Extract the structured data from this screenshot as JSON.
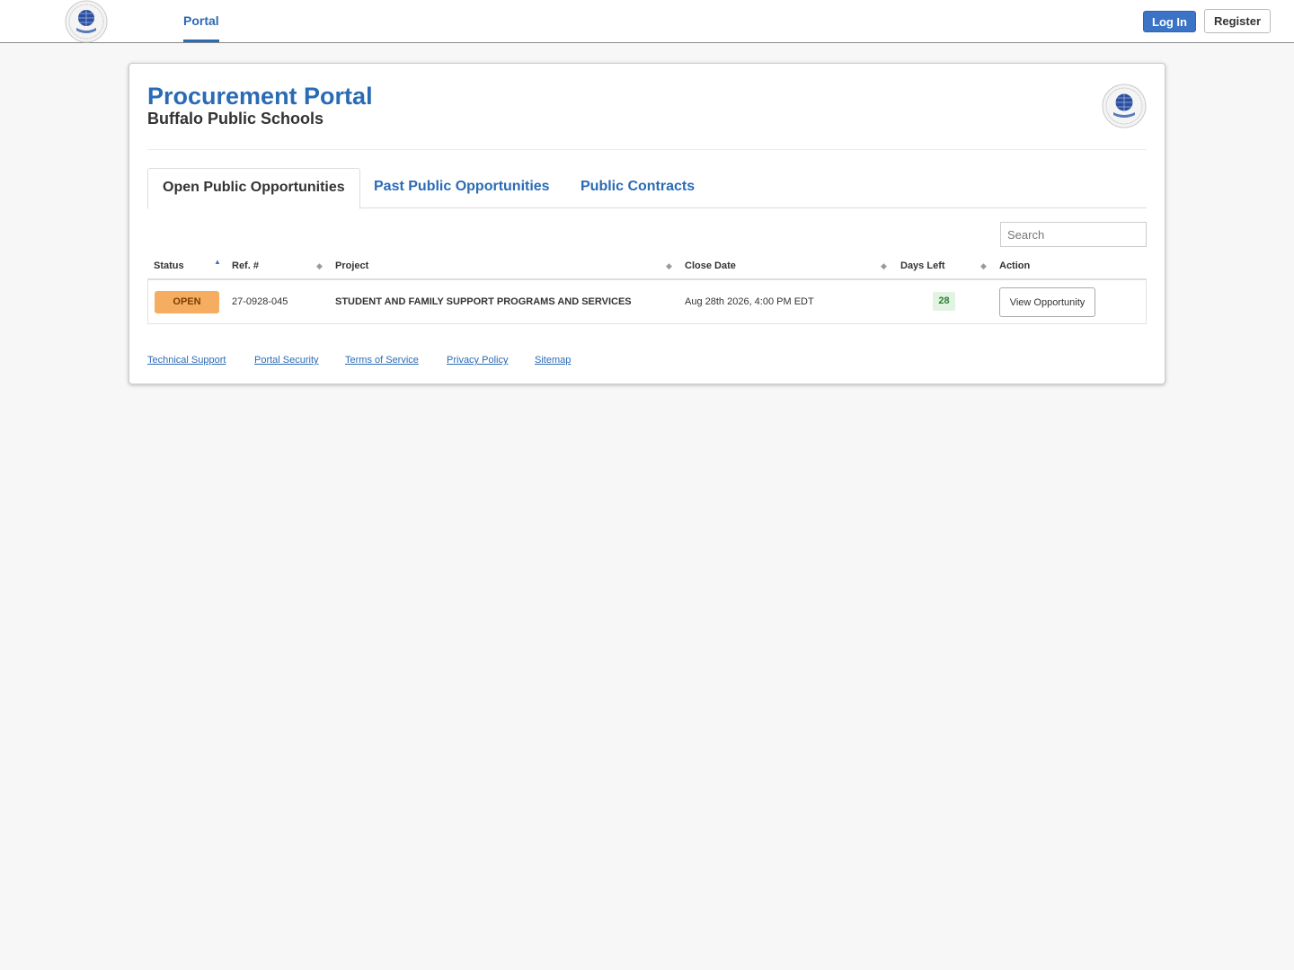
{
  "nav": {
    "portal_label": "Portal",
    "login_label": "Log In",
    "register_label": "Register"
  },
  "header": {
    "title": "Procurement Portal",
    "subtitle": "Buffalo Public Schools"
  },
  "tabs": [
    {
      "label": "Open Public Opportunities",
      "active": true
    },
    {
      "label": "Past Public Opportunities",
      "active": false
    },
    {
      "label": "Public Contracts",
      "active": false
    }
  ],
  "search": {
    "placeholder": "Search",
    "value": ""
  },
  "table": {
    "columns": [
      "Status",
      "Ref. #",
      "Project",
      "Close Date",
      "Days Left",
      "Action"
    ],
    "rows": [
      {
        "status": "OPEN",
        "ref": "27-0928-045",
        "project": "STUDENT AND FAMILY SUPPORT PROGRAMS AND SERVICES",
        "close_date": "Aug 28th 2026, 4:00 PM EDT",
        "days_left": "28",
        "action": "View Opportunity"
      }
    ]
  },
  "footer": {
    "links": [
      "Technical Support",
      "Portal Security",
      "Terms of Service",
      "Privacy Policy",
      "Sitemap"
    ]
  },
  "colors": {
    "brand_blue": "#2a6bb5",
    "login_button": "#3b74c6",
    "status_open": "#f5ad62",
    "days_left_bg": "#e2f3e2",
    "page_bg": "#f7f7f7"
  },
  "icons": {
    "logo": "district-seal-globe-icon",
    "sort_asc": "sort-ascending-icon",
    "sort_both": "sort-both-icon"
  }
}
